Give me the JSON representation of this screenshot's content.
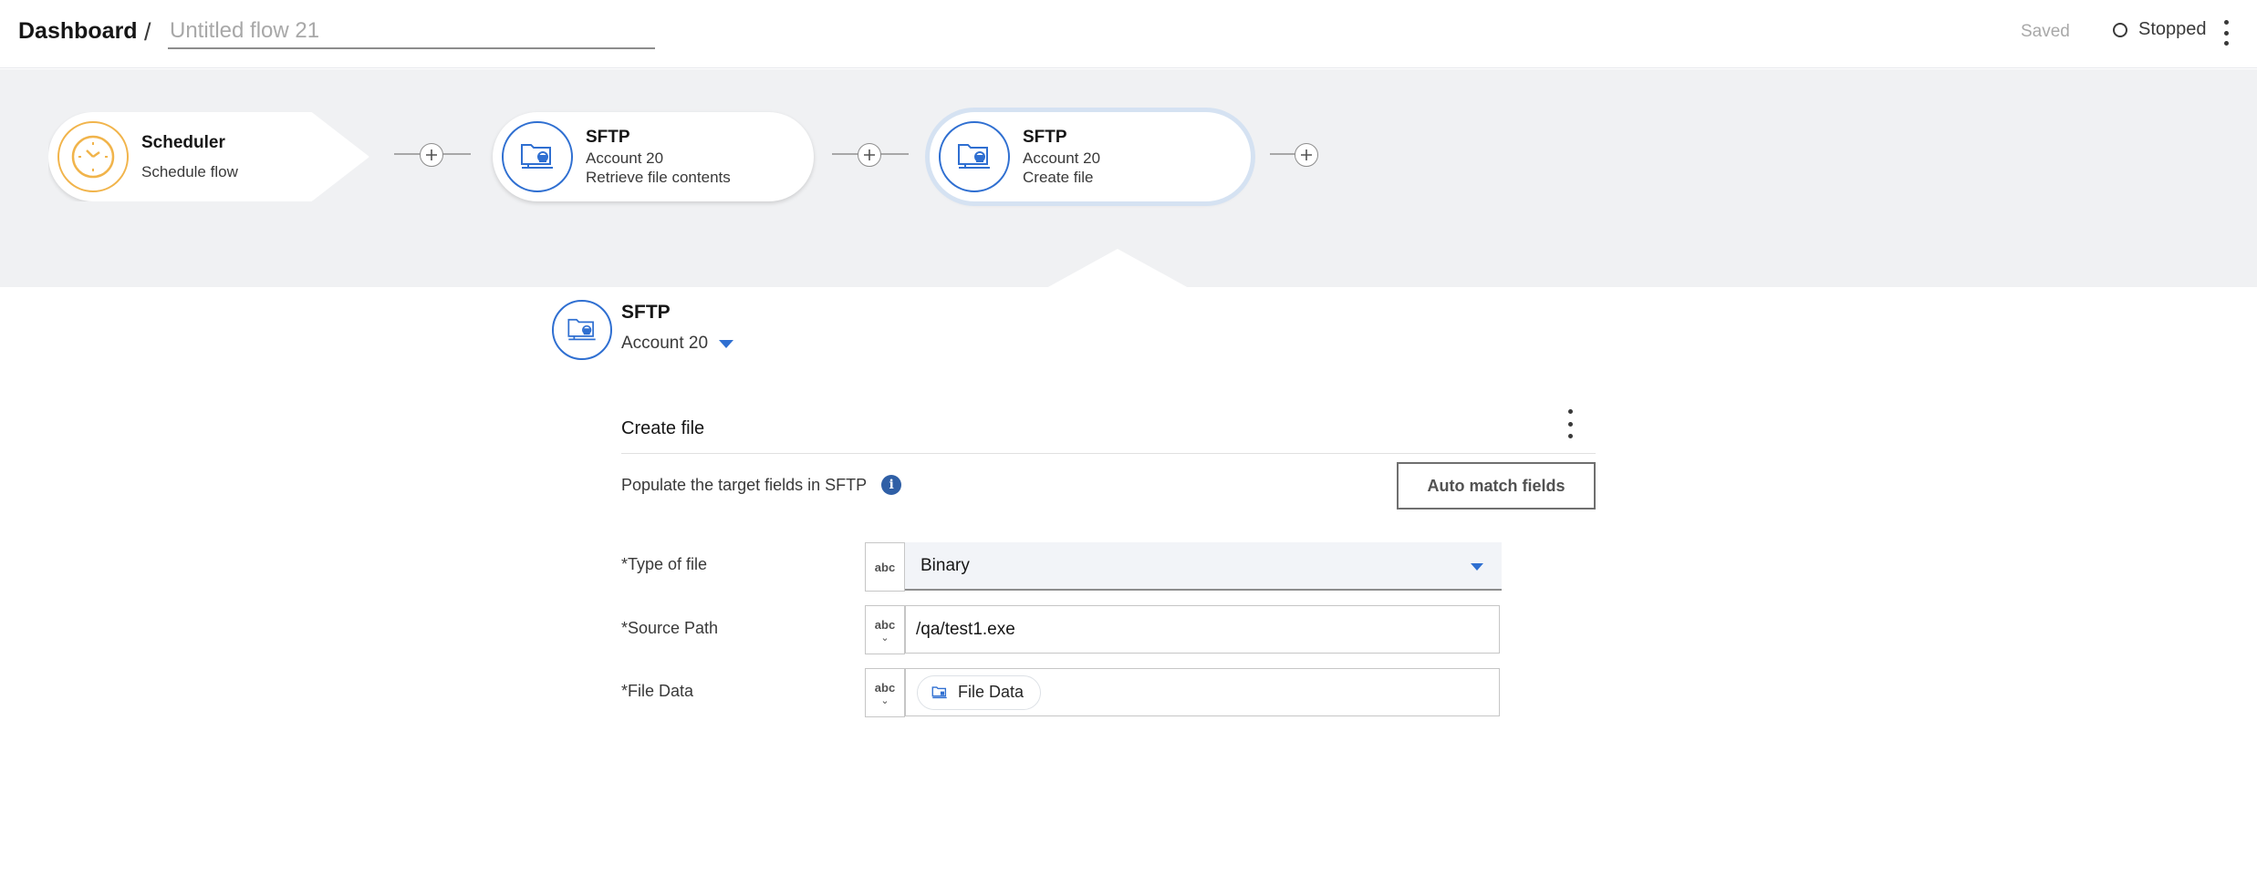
{
  "header": {
    "breadcrumb": "Dashboard",
    "separator": "/",
    "flow_name_placeholder": "Untitled flow 21",
    "save_status": "Saved",
    "run_status": "Stopped"
  },
  "flow": {
    "nodes": [
      {
        "title": "Scheduler",
        "line1": "Schedule flow",
        "line2": ""
      },
      {
        "title": "SFTP",
        "line1": "Account 20",
        "line2": "Retrieve file contents"
      },
      {
        "title": "SFTP",
        "line1": "Account 20",
        "line2": "Create file"
      }
    ]
  },
  "panel": {
    "app_name": "SFTP",
    "account": "Account 20",
    "section_title": "Create file",
    "populate_text": "Populate the target fields in SFTP",
    "auto_match_label": "Auto match fields",
    "fields": [
      {
        "label": "*Type of file",
        "type_badge": "abc",
        "value": "Binary"
      },
      {
        "label": "*Source Path",
        "type_badge": "abc",
        "value": "/qa/test1.exe"
      },
      {
        "label": "*File Data",
        "type_badge": "abc",
        "value": "File Data"
      }
    ]
  },
  "colors": {
    "accent": "#2f6fd1",
    "scheduler_accent": "#f1b44b",
    "canvas_bg": "#f0f1f3",
    "info_icon": "#2f5fa6"
  }
}
